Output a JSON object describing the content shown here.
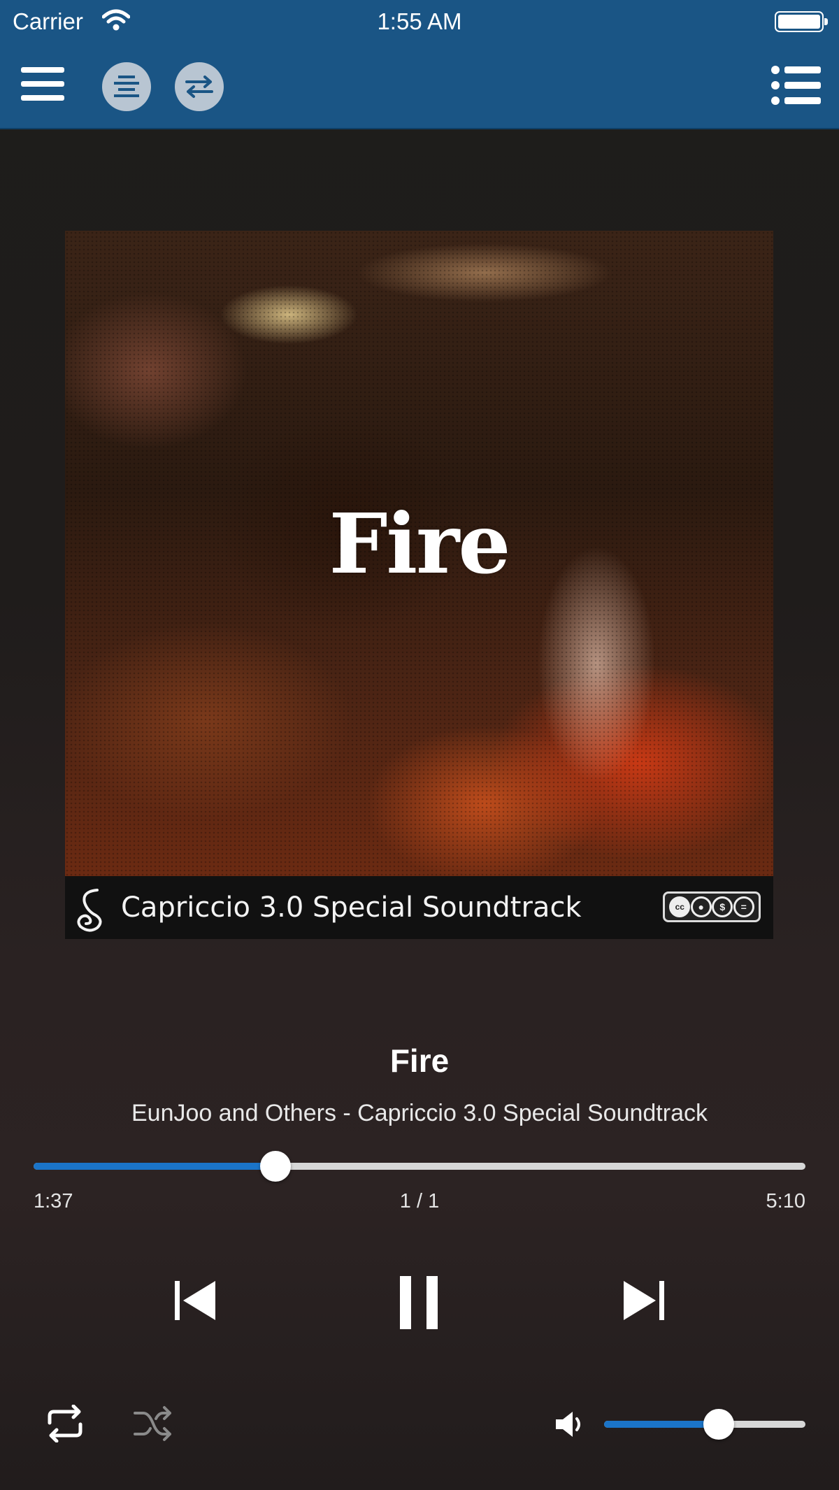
{
  "status_bar": {
    "carrier": "Carrier",
    "time": "1:55 AM"
  },
  "nav": {
    "icons": [
      "menu-icon",
      "align-center-icon",
      "swap-icon",
      "list-icon"
    ]
  },
  "artwork": {
    "title": "Fire",
    "banner_text": "Capriccio 3.0 Special Soundtrack",
    "license_badge": [
      "cc",
      "by",
      "nc",
      "nd"
    ]
  },
  "track": {
    "title": "Fire",
    "subtitle": "EunJoo and Others - Capriccio 3.0 Special Soundtrack"
  },
  "progress": {
    "elapsed": "1:37",
    "queue_position": "1 / 1",
    "total": "5:10",
    "fraction": 0.313
  },
  "volume": {
    "fraction": 0.57
  },
  "colors": {
    "nav_bar": "#1a5585",
    "accent": "#1b74c8",
    "track_unfilled": "#d7d7d7"
  }
}
